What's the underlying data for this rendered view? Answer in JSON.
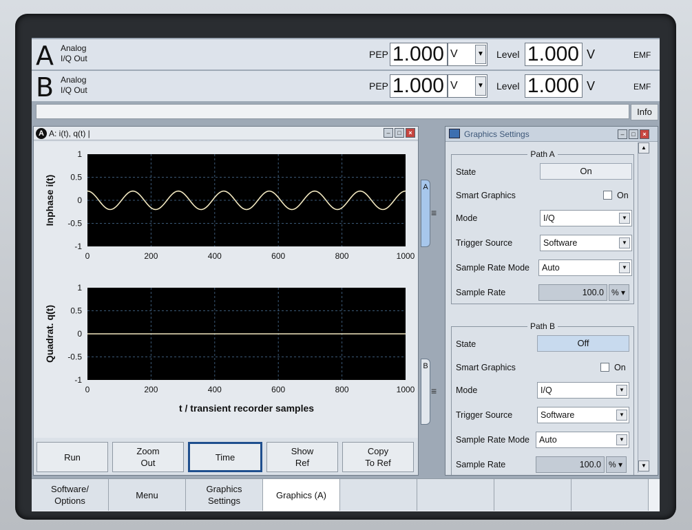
{
  "channelA": {
    "letter": "A",
    "line1": "Analog",
    "line2": "I/Q Out",
    "pep_label": "PEP",
    "pep_value": "1.000",
    "pep_unit": "V",
    "level_label": "Level",
    "level_value": "1.000",
    "level_unit": "V",
    "emf": "EMF"
  },
  "channelB": {
    "letter": "B",
    "line1": "Analog",
    "line2": "I/Q Out",
    "pep_label": "PEP",
    "pep_value": "1.000",
    "pep_unit": "V",
    "level_label": "Level",
    "level_value": "1.000",
    "level_unit": "V",
    "emf": "EMF"
  },
  "info_button": "Info",
  "graph_window": {
    "badge": "A",
    "title": "A: i(t), q(t) |",
    "buttons": [
      {
        "label": "Run"
      },
      {
        "label": "Zoom\nOut"
      },
      {
        "label": "Time"
      },
      {
        "label": "Show\nRef"
      },
      {
        "label": "Copy\nTo Ref"
      }
    ]
  },
  "chart_data": [
    {
      "type": "line",
      "ylabel": "Inphase i(t)",
      "xlim": [
        0,
        1000
      ],
      "ylim": [
        -1,
        1
      ],
      "xticks": [
        "0",
        "200",
        "400",
        "600",
        "800",
        "1000"
      ],
      "yticks": [
        "1",
        "0.5",
        "0",
        "-0.5",
        "-1"
      ],
      "grid": true,
      "series": [
        {
          "amplitude": 0.2,
          "periods": 7,
          "line_color": "#f2e8c0"
        }
      ]
    },
    {
      "type": "line",
      "ylabel": "Quadrat. q(t)",
      "xlabel": "t / transient recorder samples",
      "xlim": [
        0,
        1000
      ],
      "ylim": [
        -1,
        1
      ],
      "xticks": [
        "0",
        "200",
        "400",
        "600",
        "800",
        "1000"
      ],
      "yticks": [
        "1",
        "0.5",
        "0",
        "-0.5",
        "-1"
      ],
      "grid": true,
      "series": [
        {
          "x": [
            0,
            1000
          ],
          "y": [
            0,
            0
          ],
          "line_color": "#f2e8c0"
        }
      ]
    }
  ],
  "side_tabs": {
    "a": "A",
    "b": "B",
    "eq": "≡"
  },
  "settings": {
    "title": "Graphics Settings",
    "pathA": {
      "title": "Path A",
      "state_label": "State",
      "state_value": "On",
      "smart_label": "Smart Graphics",
      "smart_on": "On",
      "mode_label": "Mode",
      "mode_value": "I/Q",
      "trigger_label": "Trigger Source",
      "trigger_value": "Software",
      "srm_label": "Sample Rate Mode",
      "srm_value": "Auto",
      "sr_label": "Sample Rate",
      "sr_value": "100.0",
      "sr_unit": "%"
    },
    "pathB": {
      "title": "Path B",
      "state_label": "State",
      "state_value": "Off",
      "smart_label": "Smart Graphics",
      "smart_on": "On",
      "mode_label": "Mode",
      "mode_value": "I/Q",
      "trigger_label": "Trigger Source",
      "trigger_value": "Software",
      "srm_label": "Sample Rate Mode",
      "srm_value": "Auto",
      "sr_label": "Sample Rate",
      "sr_value": "100.0",
      "sr_unit": "%"
    }
  },
  "taskbar": [
    {
      "label": "Software/\nOptions"
    },
    {
      "label": "Menu"
    },
    {
      "label": "Graphics\nSettings"
    },
    {
      "label": "Graphics (A)"
    },
    {
      "label": ""
    },
    {
      "label": ""
    },
    {
      "label": ""
    },
    {
      "label": ""
    }
  ],
  "colors": {
    "plot_bg": "#000000",
    "grid": "#3c5a78",
    "trace": "#f2e8c0",
    "active_tab": "#a7c7ec"
  }
}
